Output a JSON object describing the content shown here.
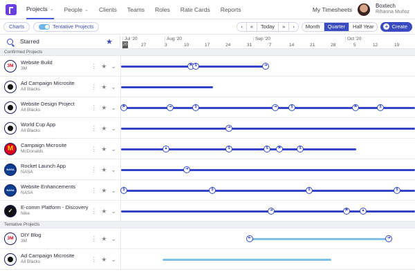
{
  "nav": {
    "items": [
      {
        "label": "Projects",
        "active": true,
        "dropdown": true
      },
      {
        "label": "People",
        "active": false,
        "dropdown": true
      },
      {
        "label": "Clients",
        "active": false,
        "dropdown": false
      },
      {
        "label": "Teams",
        "active": false,
        "dropdown": false
      },
      {
        "label": "Roles",
        "active": false,
        "dropdown": false
      },
      {
        "label": "Rate Cards",
        "active": false,
        "dropdown": false
      },
      {
        "label": "Reports",
        "active": false,
        "dropdown": false
      }
    ],
    "timesheets": "My Timesheets",
    "org": "Boxtech",
    "user": "Rihanna Muñoz"
  },
  "toolbar": {
    "charts": "Charts",
    "tentative": "Tentative Projects",
    "today": "Today",
    "views": [
      "Month",
      "Quarter",
      "Half Year"
    ],
    "selected_view": "Quarter",
    "create": "Create"
  },
  "search": {
    "value": "Starred"
  },
  "timeline": {
    "months": [
      "Jul '20",
      "Aug '20",
      "Sep '20",
      "Oct '20"
    ],
    "days": [
      "20",
      "27",
      "3",
      "10",
      "17",
      "24",
      "31",
      "7",
      "14",
      "21",
      "28",
      "5",
      "12",
      "19"
    ],
    "today_day": "20"
  },
  "sections": [
    {
      "title": "Confirmed Projects",
      "kind": "confirmed",
      "rows": [
        {
          "name": "Website Build",
          "client": "3M",
          "logo": "3m"
        },
        {
          "name": "Ad Campaign Microsite",
          "client": "All Blacks",
          "logo": "ab"
        },
        {
          "name": "Website Design Project",
          "client": "All Blacks",
          "logo": "ab"
        },
        {
          "name": "World Cup App",
          "client": "All Blacks",
          "logo": "ab"
        },
        {
          "name": "Campaign Microsite",
          "client": "McDonalds",
          "logo": "md"
        },
        {
          "name": "Rocket Launch App",
          "client": "NASA",
          "logo": "nasa"
        },
        {
          "name": "Website Enhancements",
          "client": "NASA",
          "logo": "nasa"
        },
        {
          "name": "E-comm Platform - Discovery",
          "client": "Nike",
          "logo": "nike"
        }
      ]
    },
    {
      "title": "Tentative Projects",
      "kind": "tentative",
      "rows": [
        {
          "name": "DIY Blog",
          "client": "3M",
          "logo": "3m"
        },
        {
          "name": "Ad Campaign Microsite",
          "client": "All Blacks",
          "logo": "ab"
        }
      ]
    }
  ],
  "logo_text": {
    "3m": "3M",
    "md": "M",
    "nasa": "NASA",
    "nike": "✓"
  }
}
